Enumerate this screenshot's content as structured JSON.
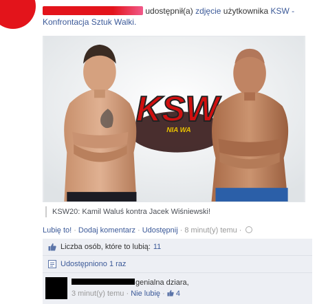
{
  "header": {
    "shared_text": "udostępnił(a)",
    "photo_link": "zdjęcie",
    "user_word": "użytkownika",
    "page_name": "KSW",
    "page_name_cont": "Konfrontacja Sztuk Walki."
  },
  "photo": {
    "logo_text": "KSW",
    "sub_text": "NIA WA"
  },
  "caption": "KSW20: Kamil Waluś kontra Jacek Wiśniewski!",
  "actions": {
    "like": "Lubię to!",
    "comment": "Dodaj komentarz",
    "share": "Udostępnij",
    "time": "8 minut(y) temu"
  },
  "feedback": {
    "likes_label": "Liczba osób, które to lubią:",
    "likes_count": "11",
    "shares_label": "Udostępniono 1 raz"
  },
  "comment": {
    "text": "genialna dziara,",
    "time": "3 minut(y) temu",
    "unlike": "Nie lubię",
    "like_count": "4"
  },
  "colors": {
    "link": "#3b5998",
    "feedback_bg": "#edeff4",
    "brand_red": "#e3141b"
  }
}
